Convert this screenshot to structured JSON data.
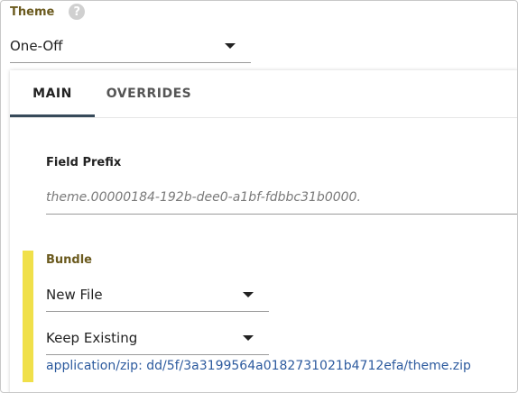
{
  "theme": {
    "label": "Theme",
    "help_glyph": "?",
    "selected": "One-Off"
  },
  "tabs": [
    {
      "label": "MAIN",
      "active": true
    },
    {
      "label": "OVERRIDES",
      "active": false
    }
  ],
  "main": {
    "field_prefix": {
      "label": "Field Prefix",
      "placeholder": "theme.00000184-192b-dee0-a1bf-fdbbc31b0000."
    },
    "bundle": {
      "label": "Bundle",
      "source_select": "New File",
      "mode_select": "Keep Existing",
      "file_link": "application/zip: dd/5f/3a3199564a0182731021b4712efa/theme.zip"
    }
  },
  "colors": {
    "label_accent": "#6b5a1e",
    "bundle_bar": "#f0e04a",
    "tab_indicator": "#374a5a",
    "link": "#2c5a9e"
  }
}
